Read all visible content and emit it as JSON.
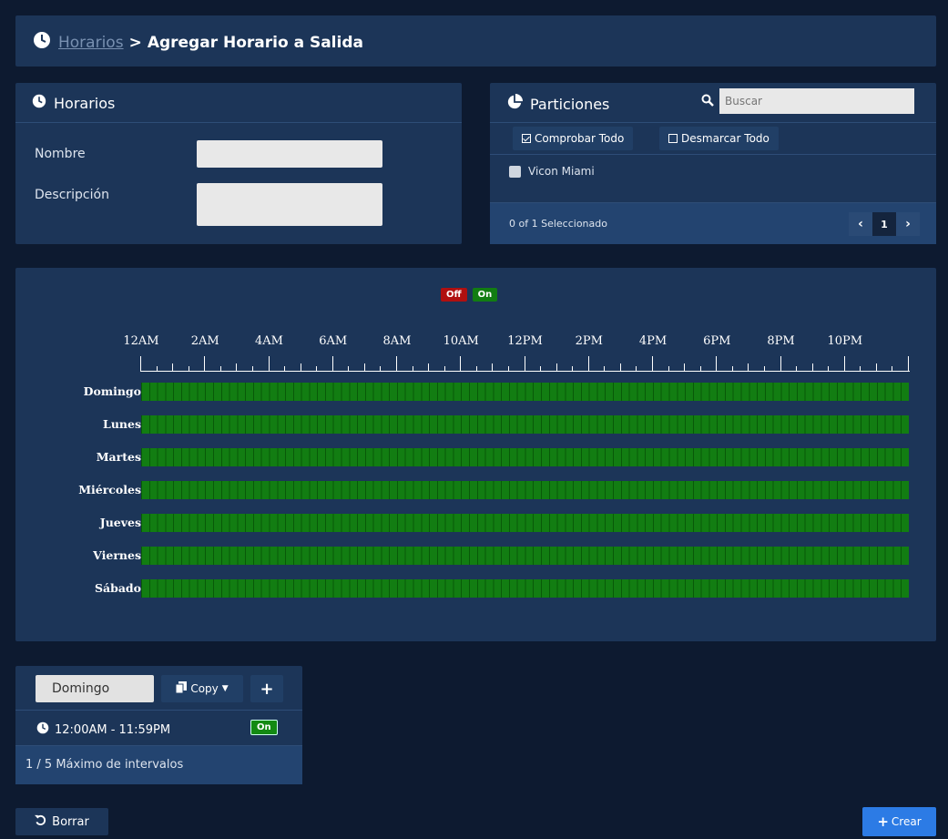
{
  "breadcrumb": {
    "link": "Horarios",
    "separator": ">",
    "current": "Agregar Horario a Salida",
    "icon": "clock-icon"
  },
  "horarios_panel": {
    "title": "Horarios",
    "nombre_label": "Nombre",
    "nombre_value": "",
    "descripcion_label": "Descripción",
    "descripcion_value": ""
  },
  "particiones_panel": {
    "title": "Particiones",
    "search_placeholder": "Buscar",
    "check_all": "Comprobar Todo",
    "uncheck_all": "Desmarcar Todo",
    "items": [
      {
        "label": "Vicon Miami",
        "checked": false
      }
    ],
    "selected_count": "0 of 1 Seleccionado",
    "page": "1"
  },
  "schedule": {
    "legend_off": "Off",
    "legend_on": "On",
    "hours": [
      "12AM",
      "2AM",
      "4AM",
      "6AM",
      "8AM",
      "10AM",
      "12PM",
      "2PM",
      "4PM",
      "6PM",
      "8PM",
      "10PM"
    ],
    "days": [
      "Domingo",
      "Lunes",
      "Martes",
      "Miércoles",
      "Jueves",
      "Viernes",
      "Sábado"
    ],
    "all_day_on": true,
    "colors": {
      "on": "#127d12",
      "off": "#b01010"
    }
  },
  "intervals_panel": {
    "selected_day": "Domingo",
    "copy_label": "Copy",
    "interval_time": "12:00AM - 11:59PM",
    "interval_state": "On",
    "max_intervals": "1 / 5 Máximo de intervalos"
  },
  "actions": {
    "reset_label": "Borrar",
    "create_label": "Crear"
  },
  "theme": {
    "background": "#0d1a30",
    "panel": "#1c3558",
    "accent": "#2c7be5"
  }
}
